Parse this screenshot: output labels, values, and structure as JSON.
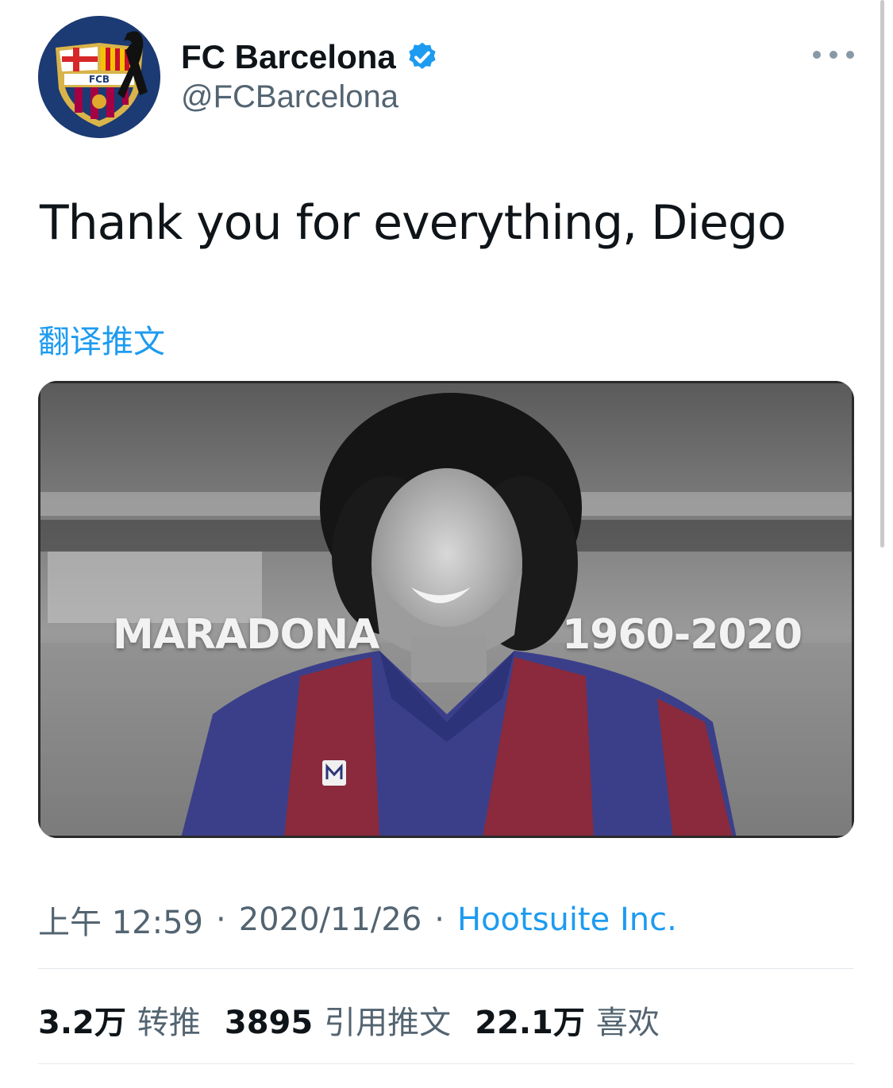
{
  "header": {
    "display_name": "FC Barcelona",
    "handle": "@FCBarcelona",
    "verified": true,
    "avatar_icon": "fc-barcelona-crest",
    "avatar_crest_text": "FCB",
    "more_icon": "more-horizontal-icon"
  },
  "tweet": {
    "text": "Thank you for everything, Diego",
    "translate_link": "翻译推文"
  },
  "media": {
    "overlay_name": "MARADONA",
    "overlay_years": "1960-2020"
  },
  "meta": {
    "time": "上午 12:59",
    "separator": "·",
    "date": "2020/11/26",
    "source": "Hootsuite Inc."
  },
  "stats": [
    {
      "value": "3.2万",
      "label": "转推"
    },
    {
      "value": "3895",
      "label": "引用推文"
    },
    {
      "value": "22.1万",
      "label": "喜欢"
    }
  ],
  "colors": {
    "link": "#1d9bf0",
    "secondary_text": "#536471",
    "barca_blue": "#1c3a73",
    "barca_red": "#a50044"
  }
}
